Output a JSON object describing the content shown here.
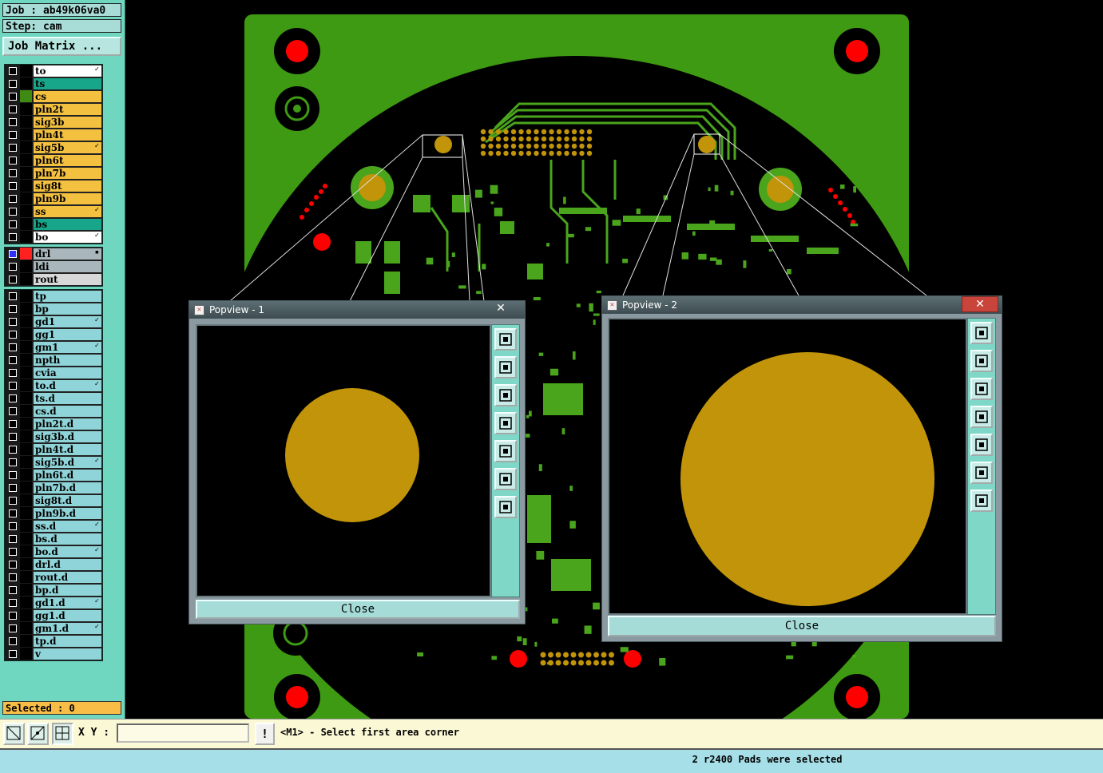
{
  "header": {
    "job_label": "Job : ab49k06va0",
    "step_label": "Step: cam",
    "job_matrix_button": "Job Matrix ..."
  },
  "layers": {
    "group1": [
      {
        "name": "to",
        "swatch": "#000000",
        "bg": "#ffffff",
        "mark": "✓"
      },
      {
        "name": "ts",
        "swatch": "#000000",
        "bg": "#17a68a",
        "mark": ""
      },
      {
        "name": "cs",
        "swatch": "#3e8a13",
        "bg": "#f3c03f",
        "mark": ""
      },
      {
        "name": "pln2t",
        "swatch": "#000000",
        "bg": "#f3c03f",
        "mark": ""
      },
      {
        "name": "sig3b",
        "swatch": "#000000",
        "bg": "#f3c03f",
        "mark": ""
      },
      {
        "name": "pln4t",
        "swatch": "#000000",
        "bg": "#f3c03f",
        "mark": ""
      },
      {
        "name": "sig5b",
        "swatch": "#000000",
        "bg": "#f3c03f",
        "mark": "✓"
      },
      {
        "name": "pln6t",
        "swatch": "#000000",
        "bg": "#f3c03f",
        "mark": ""
      },
      {
        "name": "pln7b",
        "swatch": "#000000",
        "bg": "#f3c03f",
        "mark": ""
      },
      {
        "name": "sig8t",
        "swatch": "#000000",
        "bg": "#f3c03f",
        "mark": ""
      },
      {
        "name": "pln9b",
        "swatch": "#000000",
        "bg": "#f3c03f",
        "mark": ""
      },
      {
        "name": "ss",
        "swatch": "#000000",
        "bg": "#f3c03f",
        "mark": "✓"
      },
      {
        "name": "bs",
        "swatch": "#000000",
        "bg": "#17a68a",
        "mark": ""
      },
      {
        "name": "bo",
        "swatch": "#000000",
        "bg": "#ffffff",
        "mark": "✓"
      }
    ],
    "group2": [
      {
        "name": "drl",
        "swatch": "#ff2020",
        "bg": "#a9b7bd",
        "mark": "▪"
      },
      {
        "name": "ldi",
        "swatch": "#000000",
        "bg": "#a9b7bd",
        "mark": ""
      },
      {
        "name": "rout",
        "swatch": "#000000",
        "bg": "#d8d8d8",
        "mark": ""
      }
    ],
    "group3": [
      {
        "name": "tp",
        "swatch": "#000000",
        "bg": "#8fd4d8",
        "mark": ""
      },
      {
        "name": "bp",
        "swatch": "#000000",
        "bg": "#8fd4d8",
        "mark": ""
      },
      {
        "name": "gd1",
        "swatch": "#000000",
        "bg": "#8fd4d8",
        "mark": "✓"
      },
      {
        "name": "gg1",
        "swatch": "#000000",
        "bg": "#8fd4d8",
        "mark": ""
      },
      {
        "name": "gm1",
        "swatch": "#000000",
        "bg": "#8fd4d8",
        "mark": "✓"
      },
      {
        "name": "npth",
        "swatch": "#000000",
        "bg": "#8fd4d8",
        "mark": ""
      },
      {
        "name": "cvia",
        "swatch": "#000000",
        "bg": "#8fd4d8",
        "mark": ""
      },
      {
        "name": "to.d",
        "swatch": "#000000",
        "bg": "#8fd4d8",
        "mark": "✓"
      },
      {
        "name": "ts.d",
        "swatch": "#000000",
        "bg": "#8fd4d8",
        "mark": ""
      },
      {
        "name": "cs.d",
        "swatch": "#000000",
        "bg": "#8fd4d8",
        "mark": ""
      },
      {
        "name": "pln2t.d",
        "swatch": "#000000",
        "bg": "#8fd4d8",
        "mark": ""
      },
      {
        "name": "sig3b.d",
        "swatch": "#000000",
        "bg": "#8fd4d8",
        "mark": ""
      },
      {
        "name": "pln4t.d",
        "swatch": "#000000",
        "bg": "#8fd4d8",
        "mark": ""
      },
      {
        "name": "sig5b.d",
        "swatch": "#000000",
        "bg": "#8fd4d8",
        "mark": "✓"
      },
      {
        "name": "pln6t.d",
        "swatch": "#000000",
        "bg": "#8fd4d8",
        "mark": ""
      },
      {
        "name": "pln7b.d",
        "swatch": "#000000",
        "bg": "#8fd4d8",
        "mark": ""
      },
      {
        "name": "sig8t.d",
        "swatch": "#000000",
        "bg": "#8fd4d8",
        "mark": ""
      },
      {
        "name": "pln9b.d",
        "swatch": "#000000",
        "bg": "#8fd4d8",
        "mark": ""
      },
      {
        "name": "ss.d",
        "swatch": "#000000",
        "bg": "#8fd4d8",
        "mark": "✓"
      },
      {
        "name": "bs.d",
        "swatch": "#000000",
        "bg": "#8fd4d8",
        "mark": ""
      },
      {
        "name": "bo.d",
        "swatch": "#000000",
        "bg": "#8fd4d8",
        "mark": "✓"
      },
      {
        "name": "drl.d",
        "swatch": "#000000",
        "bg": "#8fd4d8",
        "mark": ""
      },
      {
        "name": "rout.d",
        "swatch": "#000000",
        "bg": "#8fd4d8",
        "mark": ""
      },
      {
        "name": "bp.d",
        "swatch": "#000000",
        "bg": "#8fd4d8",
        "mark": ""
      },
      {
        "name": "gd1.d",
        "swatch": "#000000",
        "bg": "#8fd4d8",
        "mark": "✓"
      },
      {
        "name": "gg1.d",
        "swatch": "#000000",
        "bg": "#8fd4d8",
        "mark": ""
      },
      {
        "name": "gm1.d",
        "swatch": "#000000",
        "bg": "#8fd4d8",
        "mark": "✓"
      },
      {
        "name": "tp.d",
        "swatch": "#000000",
        "bg": "#8fd4d8",
        "mark": ""
      },
      {
        "name": "v",
        "swatch": "#000000",
        "bg": "#8fd4d8",
        "mark": ""
      }
    ]
  },
  "selected_label": "Selected : 0",
  "popups": {
    "p1": {
      "title": "Popview - 1",
      "close_x": "✕",
      "close_label": "Close"
    },
    "p2": {
      "title": "Popview - 2",
      "close_x": "✕",
      "close_label": "Close"
    }
  },
  "popup_tools": [
    "zoom-fit-icon",
    "pan-up-icon",
    "pan-down-icon",
    "pan-left-icon",
    "pan-right-icon",
    "zoom-out-icon",
    "zoom-in-icon"
  ],
  "command_bar": {
    "xy_label": "X Y :",
    "xy_value": "",
    "alert_label": "!",
    "prompt": "<M1> - Select first area corner"
  },
  "status": "2 r2400 Pads were selected",
  "colors": {
    "board_green": "#3e9a12",
    "trace_green": "#4aa41c",
    "pad_gold": "#c1940a",
    "drill_red": "#ff0000",
    "panel_teal": "#6fd6c0"
  }
}
